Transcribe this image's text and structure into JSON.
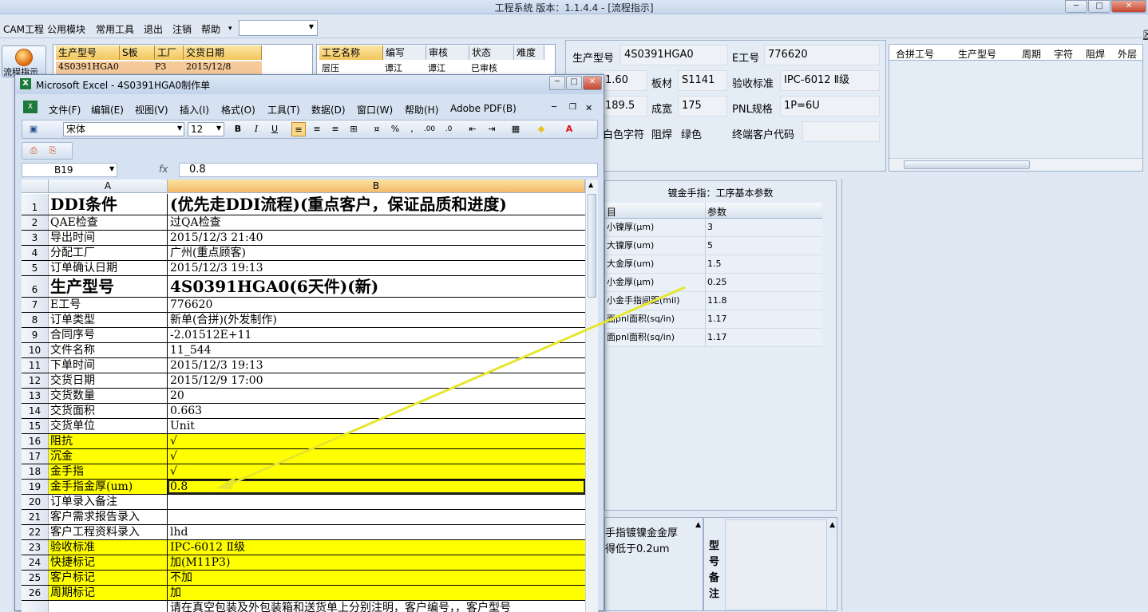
{
  "app": {
    "title": "工程系统   版本：1.1.4.4 - [流程指示]"
  },
  "menu": [
    "CAM工程",
    "公用模块",
    "常用工具",
    "退出",
    "注销",
    "帮助"
  ],
  "flow_button": {
    "label": "流程指示"
  },
  "top_grid": {
    "headers": [
      "生产型号",
      "S板",
      "工厂",
      "交货日期"
    ],
    "row": [
      "4S0391HGA0",
      "",
      "P3",
      "2015/12/8"
    ]
  },
  "process_grid": {
    "headers": [
      "工艺名称",
      "编写",
      "审核",
      "状态",
      "难度"
    ],
    "row": [
      "层压",
      "谭江",
      "谭江",
      "已审核",
      ""
    ]
  },
  "info": {
    "model_label": "生产型号",
    "model_value": "4S0391HGA0",
    "e_label": "E工号",
    "e_value": "776620",
    "v1": "1.60",
    "sheet_label": "板材",
    "sheet_value": "S1141",
    "accept_label": "验收标准",
    "accept_value": "IPC-6012 Ⅱ级",
    "v2": "189.5",
    "width_label": "成宽",
    "width_value": "175",
    "pnl_label": "PNL规格",
    "pnl_value": "1P=6U",
    "char_label": "白色字符",
    "mask_label": "阻焊",
    "mask_value": "绿色",
    "endcust_label": "终端客户代码",
    "endcust_value": ""
  },
  "merge_grid": {
    "headers": [
      "合拼工号",
      "生产型号",
      "周期",
      "字符",
      "阻焊",
      "外层"
    ]
  },
  "params": {
    "title": "镀金手指：工序基本参数",
    "col1": "目",
    "col2": "参数",
    "rows": [
      {
        "name": "小镍厚(μm)",
        "value": "3"
      },
      {
        "name": "大镍厚(um)",
        "value": "5"
      },
      {
        "name": "大金厚(um)",
        "value": "1.5"
      },
      {
        "name": "小金厚(μm)",
        "value": "0.25"
      },
      {
        "name": "小金手指间距(mil)",
        "value": "11.8"
      },
      {
        "name": "面pnl面积(sq/in)",
        "value": "1.17"
      },
      {
        "name": "面pnl面积(sq/in)",
        "value": "1.17"
      }
    ]
  },
  "note": {
    "line1": "手指镀镍金金厚",
    "line2": "得低于0.2um",
    "side": "型号备注"
  },
  "excel": {
    "title": "Microsoft Excel - 4S0391HGA0制作单",
    "menu": [
      "文件(F)",
      "编辑(E)",
      "视图(V)",
      "插入(I)",
      "格式(O)",
      "工具(T)",
      "数据(D)",
      "窗口(W)",
      "帮助(H)",
      "Adobe PDF(B)"
    ],
    "font": "宋体",
    "size": "12",
    "cell_ref": "B19",
    "formula": "0.8",
    "col_a": "A",
    "col_b": "B",
    "rows": [
      {
        "n": "1",
        "a": "DDI条件",
        "b": "(优先走DDI流程)(重点客户，保证品质和进度)",
        "big": true
      },
      {
        "n": "2",
        "a": "QAE检查",
        "b": "过QA检查"
      },
      {
        "n": "3",
        "a": "导出时间",
        "b": "2015/12/3 21:40"
      },
      {
        "n": "4",
        "a": "分配工厂",
        "b": "广州(重点顾客)"
      },
      {
        "n": "5",
        "a": "订单确认日期",
        "b": "2015/12/3 19:13"
      },
      {
        "n": "6",
        "a": "生产型号",
        "b": "4S0391HGA0(6天件)(新)",
        "big": true
      },
      {
        "n": "7",
        "a": "E工号",
        "b": "776620"
      },
      {
        "n": "8",
        "a": "订单类型",
        "b": "新单(合拼)(外发制作)"
      },
      {
        "n": "9",
        "a": "合同序号",
        "b": "-2.01512E+11"
      },
      {
        "n": "10",
        "a": "文件名称",
        "b": "11_544"
      },
      {
        "n": "11",
        "a": "下单时间",
        "b": "2015/12/3 19:13"
      },
      {
        "n": "12",
        "a": "交货日期",
        "b": "2015/12/9 17:00"
      },
      {
        "n": "13",
        "a": "交货数量",
        "b": "20"
      },
      {
        "n": "14",
        "a": "交货面积",
        "b": "0.663"
      },
      {
        "n": "15",
        "a": "交货单位",
        "b": "Unit"
      },
      {
        "n": "16",
        "a": "阻抗",
        "b": "√",
        "yellow": true
      },
      {
        "n": "17",
        "a": "沉金",
        "b": "√",
        "yellow": true
      },
      {
        "n": "18",
        "a": "金手指",
        "b": "√",
        "yellow": true
      },
      {
        "n": "19",
        "a": "金手指金厚(um)",
        "b": "0.8",
        "yellow": true,
        "selected": true
      },
      {
        "n": "20",
        "a": "订单录入备注",
        "b": ""
      },
      {
        "n": "21",
        "a": "客户需求报告录入",
        "b": ""
      },
      {
        "n": "22",
        "a": "客户工程资料录入",
        "b": "lhd"
      },
      {
        "n": "23",
        "a": "验收标准",
        "b": "IPC-6012 Ⅱ级",
        "yellow": true
      },
      {
        "n": "24",
        "a": "快捷标记",
        "b": "加(M11P3)",
        "yellow": true
      },
      {
        "n": "25",
        "a": "客户标记",
        "b": "不加",
        "yellow": true
      },
      {
        "n": "26",
        "a": "周期标记",
        "b": "加",
        "yellow": true
      },
      {
        "n": "",
        "a": "",
        "b": "请在真空包装及外包装箱和送货单上分别注明，客户编号，，客户型号"
      }
    ]
  },
  "colors": {
    "accent": "#f2c55a",
    "yellow": "#ffff00",
    "arrow": "#e6e62e"
  }
}
